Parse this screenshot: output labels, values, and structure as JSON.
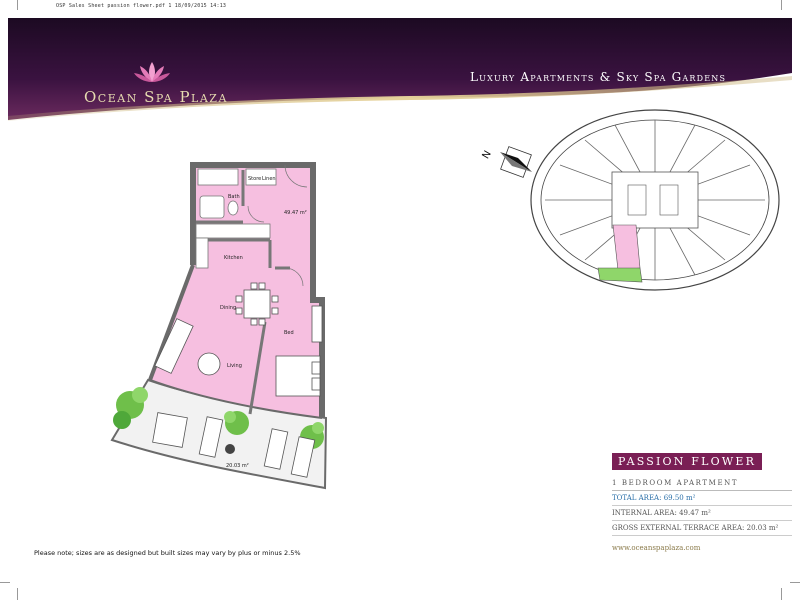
{
  "file_line": "OSP Sales Sheet passion flower.pdf   1   18/09/2015   14:13",
  "brand": {
    "name": "Ocean Spa Plaza",
    "tagline": "Luxury Apartments & Sky Spa Gardens"
  },
  "plan": {
    "rooms": {
      "bath": "Bath",
      "store": "Store",
      "linen": "Linen",
      "internal_area": "49.47 m²",
      "kitchen": "Kitchen",
      "dining": "Dining",
      "bed": "Bed",
      "living": "Living",
      "terrace_area": "20.03 m²"
    },
    "compass": "N"
  },
  "note": "Please note; sizes are as designed but built sizes may vary by plus or minus 2.5%",
  "apartment": {
    "name": "PASSION FLOWER",
    "type": "1 BEDROOM APARTMENT",
    "total_area": "TOTAL AREA: 69.50 m²",
    "internal_area": "INTERNAL AREA: 49.47 m²",
    "terrace_area": "GROSS EXTERNAL TERRACE AREA: 20.03 m²",
    "website": "www.oceanspaplaza.com"
  },
  "colors": {
    "header_purple": "#2a0d2e",
    "plan_pink": "#f6bfe0",
    "wall": "#6a6a6a",
    "title_box": "#7a1f55",
    "total_area_blue": "#2a6fa8"
  }
}
